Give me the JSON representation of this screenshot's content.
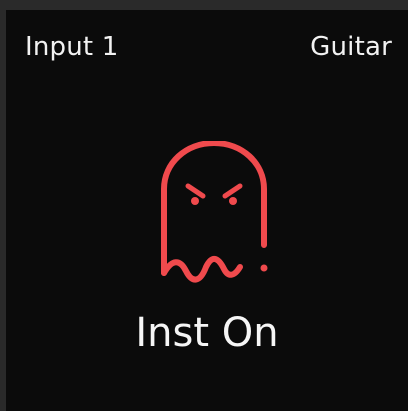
{
  "header": {
    "input_label": "Input 1",
    "source_label": "Guitar"
  },
  "ghost": {
    "icon": "angry-ghost-icon",
    "color": "#f04a4d"
  },
  "status": {
    "text": "Inst On"
  },
  "colors": {
    "panel": "#0b0b0b",
    "frame": "#2a2a2a",
    "text": "#f2f2f2",
    "accent": "#f04a4d"
  }
}
